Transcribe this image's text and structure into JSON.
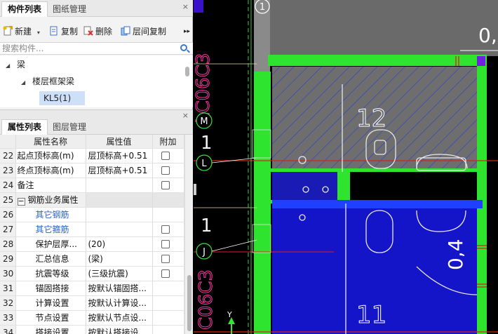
{
  "components_panel": {
    "tabs": [
      {
        "label": "构件列表"
      },
      {
        "label": "图纸管理"
      }
    ],
    "close": "×",
    "toolbar": {
      "new_label": "新建",
      "copy_label": "复制",
      "delete_label": "删除",
      "floor_copy_label": "层间复制",
      "more_label": "▸▸"
    },
    "search": {
      "placeholder": "搜索构件..."
    },
    "tree": [
      {
        "label": "梁"
      },
      {
        "label": "楼层框架梁"
      },
      {
        "label": "KL5(1)"
      }
    ]
  },
  "properties_panel": {
    "tabs": [
      {
        "label": "属性列表"
      },
      {
        "label": "图层管理"
      }
    ],
    "close": "×",
    "headers": {
      "num": "",
      "name": "属性名称",
      "value": "属性值",
      "extra": "附加"
    },
    "rows": [
      {
        "num": "22",
        "name": "起点顶标高(m)",
        "value": "层顶标高+0.51"
      },
      {
        "num": "23",
        "name": "终点顶标高(m)",
        "value": "层顶标高+0.51"
      },
      {
        "num": "24",
        "name": "备注",
        "value": ""
      },
      {
        "num": "25",
        "name": "钢筋业务属性",
        "value": ""
      },
      {
        "num": "26",
        "name": "其它钢筋",
        "value": ""
      },
      {
        "num": "27",
        "name": "其它箍筋",
        "value": ""
      },
      {
        "num": "28",
        "name": "保护层厚...",
        "value": "(20)"
      },
      {
        "num": "29",
        "name": "汇总信息",
        "value": "(梁)"
      },
      {
        "num": "30",
        "name": "抗震等级",
        "value": "(三级抗震)"
      },
      {
        "num": "31",
        "name": "锚固搭接",
        "value": "按默认锚固搭..."
      },
      {
        "num": "32",
        "name": "计算设置",
        "value": "按默认计算设..."
      },
      {
        "num": "33",
        "name": "节点设置",
        "value": "按默认节点设..."
      },
      {
        "num": "34",
        "name": "搭接设置",
        "value": "按默认搭接设..."
      }
    ]
  },
  "cad": {
    "axis_top": "1",
    "axis_m": "M",
    "axis_l": "L",
    "axis_j": "J",
    "axis_bottom": "Y",
    "beam_label_1": "LC06C3",
    "beam_label_2": "C06C3",
    "room_1": "12",
    "room_2": "11",
    "dim_1": "0,",
    "dim_2": "0,4",
    "small_1": "1",
    "small_2": "1"
  }
}
